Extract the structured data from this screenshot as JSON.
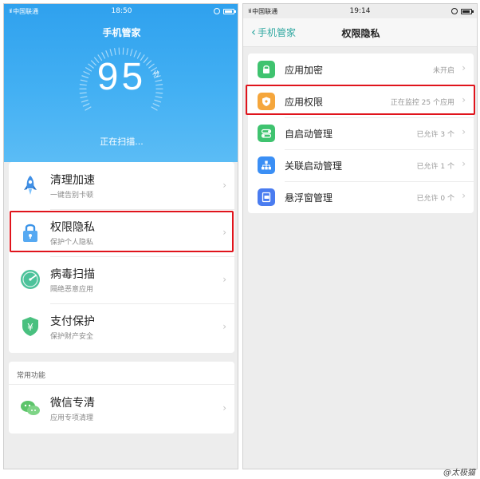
{
  "left": {
    "status": {
      "carrier": "中国联通",
      "time": "18:50"
    },
    "title": "手机管家",
    "score": "95",
    "score_unit": "分",
    "scanning": "正在扫描...",
    "items": [
      {
        "title": "清理加速",
        "subtitle": "一键告别卡顿",
        "icon": "rocket-icon"
      },
      {
        "title": "权限隐私",
        "subtitle": "保护个人隐私",
        "icon": "lock-icon"
      },
      {
        "title": "病毒扫描",
        "subtitle": "隔绝恶意应用",
        "icon": "scan-icon"
      },
      {
        "title": "支付保护",
        "subtitle": "保护财产安全",
        "icon": "yuan-shield-icon"
      }
    ],
    "common_label": "常用功能",
    "common_items": [
      {
        "title": "微信专清",
        "subtitle": "应用专项清理",
        "icon": "wechat-icon"
      }
    ],
    "colors": {
      "header_top": "#2fa1ee",
      "header_bottom": "#5bbcf5",
      "highlight": "#e0141c"
    }
  },
  "right": {
    "status": {
      "carrier": "中国联通",
      "time": "19:14"
    },
    "back_label": "手机管家",
    "title": "权限隐私",
    "items": [
      {
        "label": "应用加密",
        "value": "未开启",
        "icon": "lock-icon",
        "color": "#3fc36f"
      },
      {
        "label": "应用权限",
        "value": "正在监控 25 个应用",
        "icon": "shield-icon",
        "color": "#f5a63c"
      },
      {
        "label": "自启动管理",
        "value": "已允许 3 个",
        "icon": "toggle-icon",
        "color": "#3fc36f"
      },
      {
        "label": "关联启动管理",
        "value": "已允许 1 个",
        "icon": "network-icon",
        "color": "#3b8ff5"
      },
      {
        "label": "悬浮窗管理",
        "value": "已允许 0 个",
        "icon": "floating-window-icon",
        "color": "#4a7cf0"
      }
    ]
  },
  "watermark": "@太极猫"
}
